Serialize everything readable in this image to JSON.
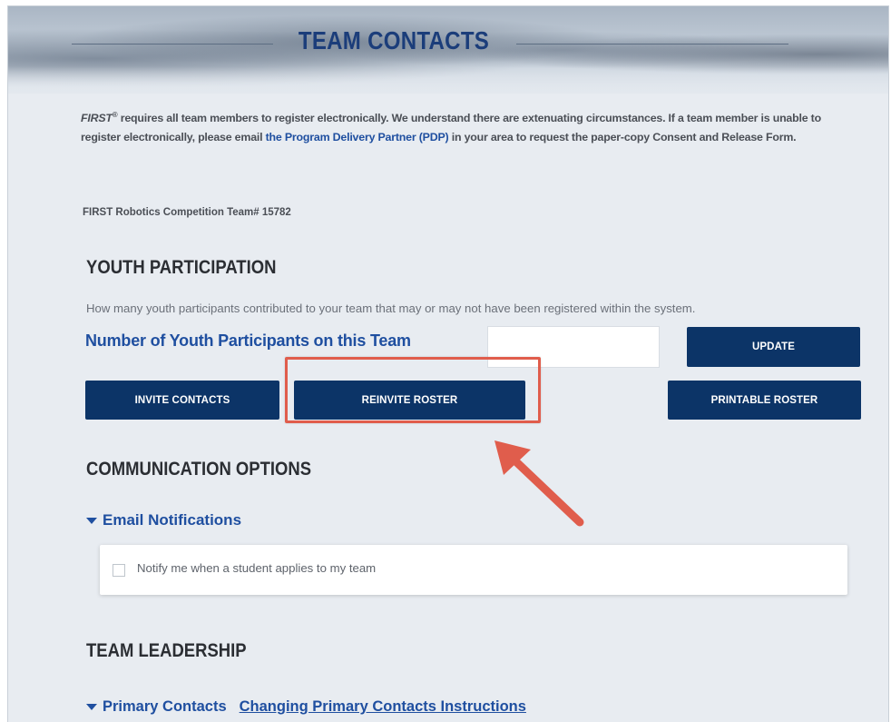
{
  "banner": {
    "title": "TEAM CONTACTS"
  },
  "notice": {
    "first": "FIRST",
    "reg_mark": "®",
    "text_1": " requires all team members to register electronically. We understand there are extenuating circumstances. If a team member is unable to register electronically, please email ",
    "link": "the Program Delivery Partner (PDP)",
    "text_2": " in your area to request the paper-copy Consent and Release Form."
  },
  "team_number": "FIRST Robotics Competition Team# 15782",
  "youth": {
    "heading": "YOUTH PARTICIPATION",
    "description": "How many youth participants contributed to your team that may or may not have been registered within the system.",
    "count_label": "Number of Youth Participants on this Team",
    "count_value": "",
    "update_label": "UPDATE",
    "invite_label": "INVITE CONTACTS",
    "reinvite_label": "REINVITE ROSTER",
    "printable_label": "PRINTABLE ROSTER"
  },
  "communication": {
    "heading": "COMMUNICATION OPTIONS",
    "email_toggle": "Email Notifications",
    "notify_label": "Notify me when a student applies to my team",
    "notify_checked": false
  },
  "leadership": {
    "heading": "TEAM LEADERSHIP",
    "primary_toggle": "Primary Contacts",
    "instructions_link": "Changing Primary Contacts Instructions"
  },
  "colors": {
    "brand_blue": "#0c3467",
    "link_blue": "#1f4fa0",
    "annotation_red": "#e05d4c"
  },
  "icons": {
    "caret": "caret-down-icon",
    "arrow": "annotation-arrow-icon"
  }
}
